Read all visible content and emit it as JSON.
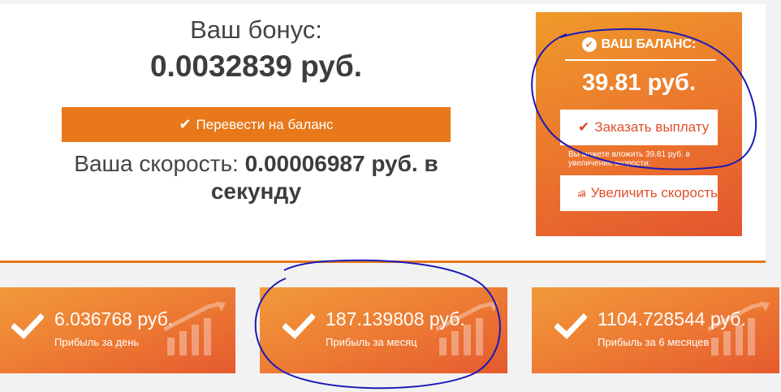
{
  "bonus": {
    "label": "Ваш бонус:",
    "value": "0.0032839 руб.",
    "transfer_button": "Перевести на баланс"
  },
  "speed": {
    "label": "Ваша скорость:",
    "value": "0.00006987 руб. в секунду"
  },
  "balance": {
    "title": "ВАШ БАЛАНС:",
    "amount": "39.81 руб.",
    "order_button": "Заказать выплату",
    "note": "Вы можете вложить 39.81 руб. в увеличение скорости:",
    "speed_button": "Увеличить скорость"
  },
  "cards": [
    {
      "amount": "6.036768 руб.",
      "label": "Прибыль за день"
    },
    {
      "amount": "187.139808 руб.",
      "label": "Прибыль за месяц"
    },
    {
      "amount": "1104.728544 руб.",
      "label": "Прибыль за 6 месяцев"
    }
  ],
  "colors": {
    "accent": "#e8781a",
    "annotation": "#1a1ab8"
  },
  "icons": [
    "check-icon",
    "check-circle-icon",
    "bar-chart-icon"
  ]
}
